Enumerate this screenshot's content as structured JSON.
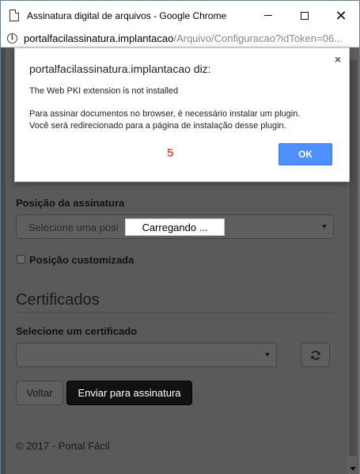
{
  "window": {
    "title": "Assinatura digital de arquivos - Google Chrome",
    "url_host": "portalfacilassinatura.implantacao",
    "url_path": "/Arquivo/Configuracao?idToken=06..."
  },
  "page": {
    "position_label": "Posição da assinatura",
    "position_select_placeholder": "Selecione uma posi",
    "loading_text": "Carregando ...",
    "custom_position_label": "Posição customizada",
    "certificates_heading": "Certificados",
    "certificate_select_label": "Selecione um certificado",
    "certificate_select_value": "",
    "back_button": "Voltar",
    "submit_button": "Enviar para assinatura",
    "footer": "© 2017 - Portal Fácil"
  },
  "dialog": {
    "title": "portalfacilassinatura.implantacao diz:",
    "message_line1": "The Web PKI extension is not installed",
    "message_line2": "Para assinar documentos no browser, é necessário instalar um plugin.",
    "message_line3": "Você será redirecionado para a página de instalação desse plugin.",
    "countdown": "5",
    "ok_button": "OK",
    "close_glyph": "×"
  },
  "colors": {
    "overlay": "#5a5a5a",
    "ok_button": "#4d90fe",
    "countdown": "#d9534f"
  }
}
